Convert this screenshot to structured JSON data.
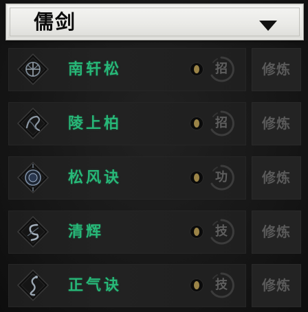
{
  "header": {
    "title": "儒剑"
  },
  "skills": [
    {
      "name": "南轩松",
      "type_label": "招",
      "cultivate_label": "修炼",
      "icon": "pine-emblem-icon"
    },
    {
      "name": "陵上柏",
      "type_label": "招",
      "cultivate_label": "修炼",
      "icon": "cypress-emblem-icon"
    },
    {
      "name": "松风诀",
      "type_label": "功",
      "cultivate_label": "修炼",
      "icon": "wind-orb-icon"
    },
    {
      "name": "清辉",
      "type_label": "技",
      "cultivate_label": "修炼",
      "icon": "swirl-blade-icon"
    },
    {
      "name": "正气诀",
      "type_label": "技",
      "cultivate_label": "修炼",
      "icon": "serpent-blade-icon"
    }
  ],
  "colors": {
    "skill_name": "#27b878",
    "disabled_text": "#5a5a5a",
    "header_bg": "#eeeeeb"
  }
}
